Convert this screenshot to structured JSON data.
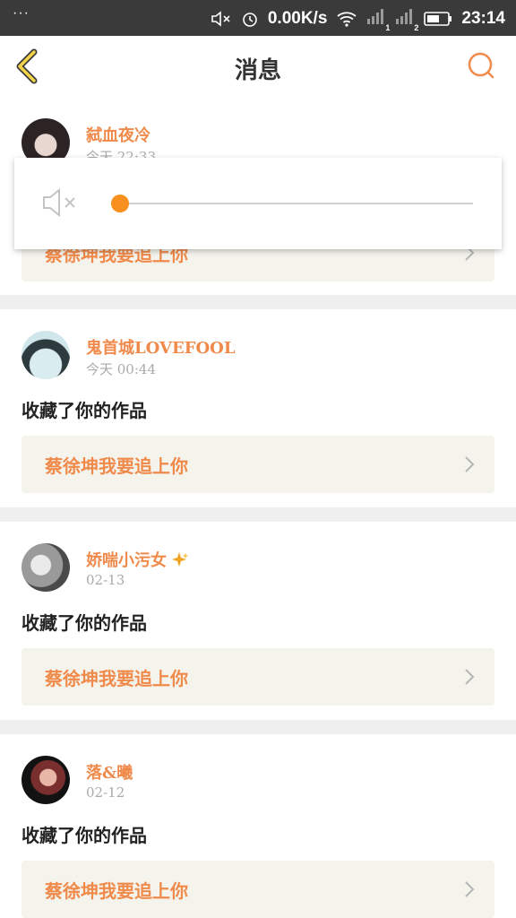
{
  "statusbar": {
    "menu": "···",
    "speed": "0.00K/s",
    "sim1": "1",
    "sim2": "2",
    "time": "23:14"
  },
  "header": {
    "title": "消息"
  },
  "colors": {
    "accent": "#f08a4b",
    "slider": "#f7901e",
    "work_bg": "#f4f3ec"
  },
  "volume_popup": {
    "level": 0,
    "muted": true
  },
  "messages": [
    {
      "username": "弑血夜冷",
      "time": "今天 22:33",
      "work": "蔡徐坤我要追上你"
    },
    {
      "username": "鬼首城LOVEFOOL",
      "time": "今天 00:44",
      "action": "收藏了你的作品",
      "work": "蔡徐坤我要追上你"
    },
    {
      "username": "娇喘小污女",
      "time": "02-13",
      "action": "收藏了你的作品",
      "work": "蔡徐坤我要追上你"
    },
    {
      "username": "落&曦",
      "time": "02-12",
      "action": "收藏了你的作品",
      "work": "蔡徐坤我要追上你"
    }
  ]
}
